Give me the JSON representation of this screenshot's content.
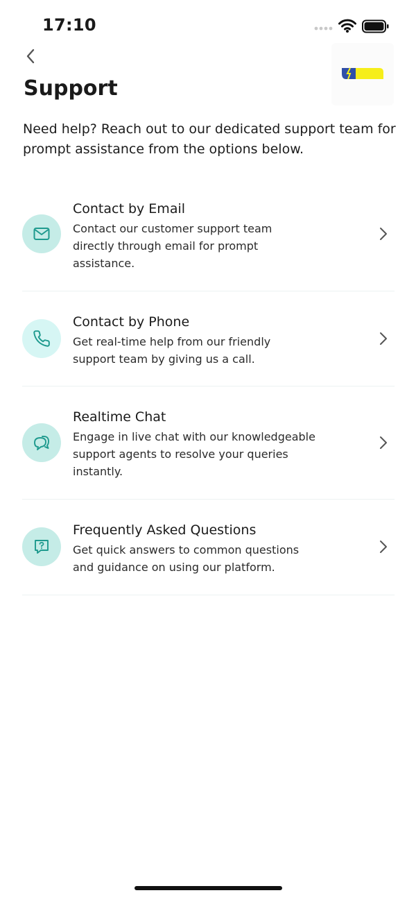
{
  "status_bar": {
    "time": "17:10"
  },
  "header": {
    "title": "Support"
  },
  "intro": {
    "text": "Need help? Reach out to our dedicated support team for prompt assistance from the options below."
  },
  "options": [
    {
      "title": "Contact by Email",
      "description": "Contact our customer support team directly through email for prompt assistance.",
      "icon": "mail-icon"
    },
    {
      "title": "Contact by Phone",
      "description": "Get real-time help from our friendly support team by giving us a call.",
      "icon": "phone-icon"
    },
    {
      "title": "Realtime Chat",
      "description": "Engage in live chat with our knowledgeable support agents to resolve your queries instantly.",
      "icon": "chat-icon"
    },
    {
      "title": "Frequently Asked Questions",
      "description": "Get quick answers to common questions and guidance on using our platform.",
      "icon": "question-message-icon"
    }
  ],
  "colors": {
    "accent": "#1e9a8e",
    "icon_bg": "#c5ece7",
    "icon_bg_phone": "#d6f6f4",
    "divider": "#ecf2f2",
    "logo_yellow": "#f6ee1a",
    "logo_blue": "#2f4fa8"
  }
}
